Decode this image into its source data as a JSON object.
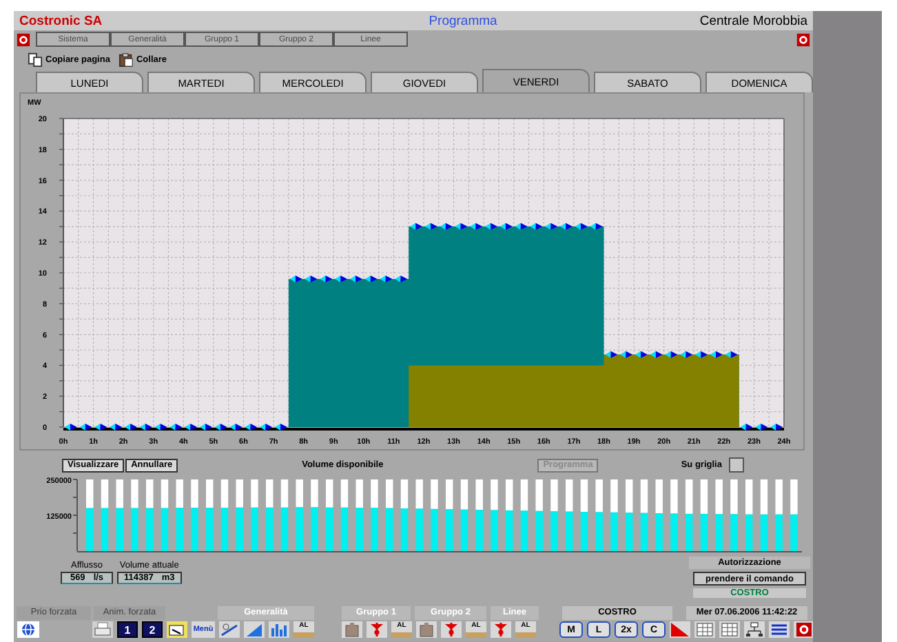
{
  "header": {
    "company": "Costronic SA",
    "title": "Programma",
    "plant": "Centrale Morobbia"
  },
  "nav_buttons": [
    {
      "label": "Sistema",
      "disabled": true
    },
    {
      "label": "Generalità",
      "disabled": true
    },
    {
      "label": "Gruppo 1",
      "disabled": true
    },
    {
      "label": "Gruppo 2",
      "disabled": true
    },
    {
      "label": "Linee",
      "disabled": true
    }
  ],
  "page_tools": [
    {
      "kind": "copy",
      "label": "Copiare pagina"
    },
    {
      "kind": "paste",
      "label": "Collare"
    }
  ],
  "day_tabs": [
    {
      "label": "LUNEDI",
      "selected": false
    },
    {
      "label": "MARTEDI",
      "selected": false
    },
    {
      "label": "MERCOLEDI",
      "selected": false
    },
    {
      "label": "GIOVEDI",
      "selected": false
    },
    {
      "label": "VENERDI",
      "selected": true
    },
    {
      "label": "SABATO",
      "selected": false
    },
    {
      "label": "DOMENICA",
      "selected": false
    }
  ],
  "power_chart": {
    "chart_data": {
      "type": "area",
      "ylabel": "MW",
      "grid": true,
      "xlim": [
        0,
        24
      ],
      "ylim": [
        0,
        20
      ],
      "x": [
        0,
        0.5,
        1,
        1.5,
        2,
        2.5,
        3,
        3.5,
        4,
        4.5,
        5,
        5.5,
        6,
        6.5,
        7,
        7.5,
        8,
        8.5,
        9,
        9.5,
        10,
        10.5,
        11,
        11.5,
        12,
        12.5,
        13,
        13.5,
        14,
        14.5,
        15,
        15.5,
        16,
        16.5,
        17,
        17.5,
        18,
        18.5,
        19,
        19.5,
        20,
        20.5,
        21,
        21.5,
        22,
        22.5,
        23,
        23.5,
        24
      ],
      "series": [
        {
          "color": "#008080",
          "values": [
            0,
            0,
            0,
            0,
            0,
            0,
            0,
            0,
            0,
            0,
            0,
            0,
            0,
            0,
            0,
            9.6,
            9.6,
            9.6,
            9.6,
            9.6,
            9.6,
            9.6,
            9.6,
            13,
            13,
            13,
            13,
            13,
            13,
            13,
            13,
            13,
            13,
            13,
            13,
            13,
            4.7,
            4.7,
            4.7,
            4.7,
            4.7,
            4.7,
            4.7,
            4.7,
            4.7,
            0,
            0,
            0,
            0
          ]
        },
        {
          "color": "#848000",
          "values": [
            0,
            0,
            0,
            0,
            0,
            0,
            0,
            0,
            0,
            0,
            0,
            0,
            0,
            0,
            0,
            0,
            0,
            0,
            0,
            0,
            0,
            0,
            0,
            4,
            4,
            4,
            4,
            4,
            4,
            4,
            4,
            4,
            4,
            4,
            4,
            4,
            4.7,
            4.7,
            4.7,
            4.7,
            4.7,
            4.7,
            4.7,
            4.7,
            4.7,
            0,
            0,
            0,
            0
          ]
        }
      ],
      "yticks": [
        0,
        2,
        4,
        6,
        8,
        10,
        12,
        14,
        16,
        18,
        20
      ],
      "xticks": [
        {
          "value": 0,
          "label": "0h"
        },
        {
          "value": 1,
          "label": "1h"
        },
        {
          "value": 2,
          "label": "2h"
        },
        {
          "value": 3,
          "label": "3h"
        },
        {
          "value": 4,
          "label": "4h"
        },
        {
          "value": 5,
          "label": "5h"
        },
        {
          "value": 6,
          "label": "6h"
        },
        {
          "value": 7,
          "label": "7h"
        },
        {
          "value": 8,
          "label": "8h"
        },
        {
          "value": 9,
          "label": "9h"
        },
        {
          "value": 10,
          "label": "10h"
        },
        {
          "value": 11,
          "label": "11h"
        },
        {
          "value": 12,
          "label": "12h"
        },
        {
          "value": 13,
          "label": "13h"
        },
        {
          "value": 14,
          "label": "14h"
        },
        {
          "value": 15,
          "label": "15h"
        },
        {
          "value": 16,
          "label": "16h"
        },
        {
          "value": 17,
          "label": "17h"
        },
        {
          "value": 18,
          "label": "18h"
        },
        {
          "value": 19,
          "label": "19h"
        },
        {
          "value": 20,
          "label": "20h"
        },
        {
          "value": 21,
          "label": "21h"
        },
        {
          "value": 22,
          "label": "22h"
        },
        {
          "value": 23,
          "label": "23h"
        },
        {
          "value": 24,
          "label": "24h"
        }
      ]
    }
  },
  "volume_panel": {
    "view_button": "Visualizzare",
    "cancel_button": "Annullare",
    "title": "Volume disponibile",
    "program_button": {
      "label": "Programma",
      "disabled": true
    },
    "grid_toggle": {
      "label": "Su griglia",
      "checked": false
    },
    "chart_data": {
      "type": "bar",
      "ylim": [
        0,
        250000
      ],
      "yticks": [
        125000,
        250000
      ],
      "series": [
        {
          "color": "#00f0f0",
          "values": [
            150000,
            150000,
            150000,
            150000,
            150000,
            150000,
            151000,
            151000,
            151000,
            151000,
            152000,
            152000,
            152000,
            152000,
            153000,
            153000,
            152000,
            152000,
            151000,
            151000,
            150000,
            149000,
            148000,
            147000,
            146000,
            145000,
            144000,
            143000,
            142000,
            141000,
            140000,
            139000,
            138000,
            137000,
            136000,
            135000,
            134000,
            133000,
            132000,
            131000,
            130000,
            130000,
            129000,
            129000,
            128000,
            128000,
            128000,
            128000
          ]
        }
      ]
    }
  },
  "readings": [
    {
      "label": "Afflusso",
      "value": "569",
      "unit": "l/s"
    },
    {
      "label": "Volume attuale",
      "value": "114387",
      "unit": "m3"
    }
  ],
  "authorization": {
    "title": "Autorizzazione",
    "button": "prendere il comando",
    "holder": "COSTRO"
  },
  "footer": {
    "headers": [
      {
        "label": "Prio forzata",
        "disabled": true
      },
      {
        "label": "Anim. forzata",
        "disabled": true
      },
      {
        "label": "Generalità",
        "disabled": false
      },
      {
        "label": "Gruppo 1",
        "disabled": false
      },
      {
        "label": "Gruppo 2",
        "disabled": false
      },
      {
        "label": "Linee",
        "disabled": false
      },
      {
        "label": "COSTRO",
        "disabled": false
      },
      {
        "label": "Mer 07.06.2006 11:42:22",
        "disabled": false
      }
    ],
    "toolbars": [
      [
        {
          "kind": "globe"
        }
      ],
      [
        {
          "kind": "printer"
        },
        {
          "kind": "number",
          "label": "1"
        },
        {
          "kind": "number",
          "label": "2"
        },
        {
          "kind": "folder"
        },
        {
          "kind": "menu",
          "label": "Menù"
        }
      ],
      [
        {
          "kind": "ruler"
        },
        {
          "kind": "triangle"
        },
        {
          "kind": "bars"
        },
        {
          "kind": "al",
          "label": "AL"
        }
      ],
      [
        {
          "kind": "pump"
        },
        {
          "kind": "valve"
        },
        {
          "kind": "al",
          "label": "AL"
        },
        {
          "kind": "pump"
        },
        {
          "kind": "valve"
        },
        {
          "kind": "al",
          "label": "AL"
        },
        {
          "kind": "valve"
        },
        {
          "kind": "al",
          "label": "AL"
        }
      ],
      [
        {
          "kind": "letter",
          "label": "M"
        },
        {
          "kind": "letter",
          "label": "L"
        },
        {
          "kind": "letter",
          "label": "2x"
        },
        {
          "kind": "letter",
          "label": "C"
        },
        {
          "kind": "ramp"
        },
        {
          "kind": "grid"
        },
        {
          "kind": "grid"
        },
        {
          "kind": "network"
        },
        {
          "kind": "list"
        },
        {
          "kind": "siren"
        }
      ]
    ]
  }
}
